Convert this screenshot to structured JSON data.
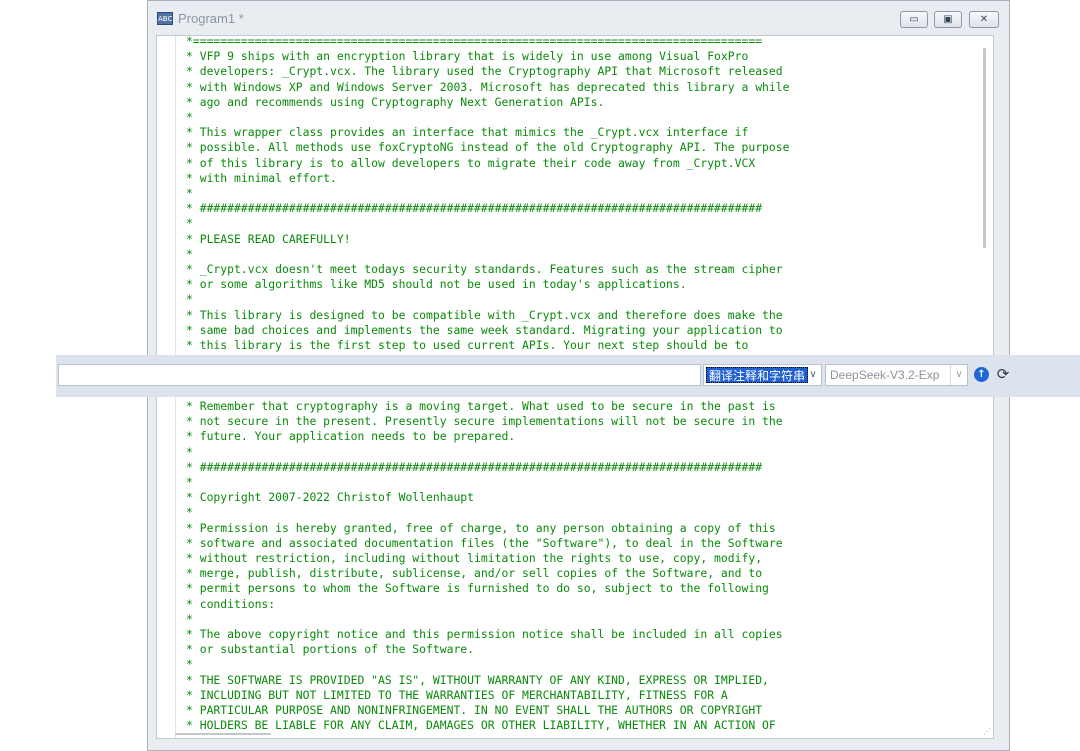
{
  "window": {
    "icon_text": "ABC",
    "title": "Program1 *",
    "min_glyph": "▭",
    "max_glyph": "▣",
    "close_glyph": "✕"
  },
  "editor": {
    "lines_top": [
      "*===================================================================================",
      "* VFP 9 ships with an encryption library that is widely in use among Visual FoxPro",
      "* developers: _Crypt.vcx. The library used the Cryptography API that Microsoft released",
      "* with Windows XP and Windows Server 2003. Microsoft has deprecated this library a while",
      "* ago and recommends using Cryptography Next Generation APIs.",
      "*",
      "* This wrapper class provides an interface that mimics the _Crypt.vcx interface if",
      "* possible. All methods use foxCryptoNG instead of the old Cryptography API. The purpose",
      "* of this library is to allow developers to migrate their code away from _Crypt.VCX",
      "* with minimal effort.",
      "*",
      "* ##################################################################################",
      "*",
      "* PLEASE READ CAREFULLY!",
      "*",
      "* _Crypt.vcx doesn't meet todays security standards. Features such as the stream cipher",
      "* or some algorithms like MD5 should not be used in today's applications.",
      "*",
      "* This library is designed to be compatible with _Crypt.vcx and therefore does make the",
      "* same bad choices and implements the same week standard. Migrating your application to",
      "* this library is the first step to used current APIs. Your next step should be to"
    ],
    "lines_bottom": [
      "* Remember that cryptography is a moving target. What used to be secure in the past is",
      "* not secure in the present. Presently secure implementations will not be secure in the",
      "* future. Your application needs to be prepared.",
      "*",
      "* ##################################################################################",
      "*",
      "* Copyright 2007-2022 Christof Wollenhaupt",
      "*",
      "* Permission is hereby granted, free of charge, to any person obtaining a copy of this",
      "* software and associated documentation files (the \"Software\"), to deal in the Software",
      "* without restriction, including without limitation the rights to use, copy, modify,",
      "* merge, publish, distribute, sublicense, and/or sell copies of the Software, and to",
      "* permit persons to whom the Software is furnished to do so, subject to the following",
      "* conditions:",
      "*",
      "* The above copyright notice and this permission notice shall be included in all copies",
      "* or substantial portions of the Software.",
      "*",
      "* THE SOFTWARE IS PROVIDED \"AS IS\", WITHOUT WARRANTY OF ANY KIND, EXPRESS OR IMPLIED,",
      "* INCLUDING BUT NOT LIMITED TO THE WARRANTIES OF MERCHANTABILITY, FITNESS FOR A",
      "* PARTICULAR PURPOSE AND NONINFRINGEMENT. IN NO EVENT SHALL THE AUTHORS OR COPYRIGHT",
      "* HOLDERS BE LIABLE FOR ANY CLAIM, DAMAGES OR OTHER LIABILITY, WHETHER IN AN ACTION OF"
    ],
    "code_color": "#0a8a0a",
    "grip_glyph": "⋰"
  },
  "translate_bar": {
    "input_value": "",
    "mode_value": "翻译注释和字符串",
    "model_value": "DeepSeek-V3.2-Exp",
    "dropdown_glyph": "∨",
    "up_glyph": "↑",
    "refresh_glyph": "⟳",
    "accent_color": "#1f67d6"
  }
}
